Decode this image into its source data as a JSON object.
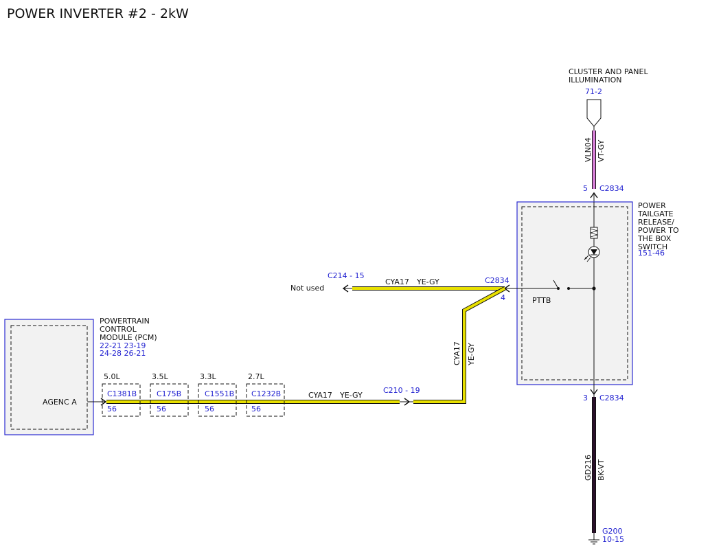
{
  "title": "POWER INVERTER #2 - 2kW",
  "colors": {
    "ye_gy_wire": "#e8e000",
    "vt_gy_wire": "#d77fd8",
    "bk_vt_wire": "#2a0f2a",
    "module_border": "#2b2bd0",
    "ref_blue": "#1f1fd0"
  },
  "cluster": {
    "line1": "CLUSTER AND PANEL",
    "line2": "ILLUMINATION",
    "ref": "71-2"
  },
  "wire_vln04": {
    "circuit": "VLN04",
    "color": "VT-GY"
  },
  "switch_module": {
    "line1": "POWER",
    "line2": "TAILGATE",
    "line3": "RELEASE/",
    "line4": "POWER TO",
    "line5": "THE BOX",
    "line6": "SWITCH",
    "ref": "151-46",
    "top_pin": "5",
    "top_connector": "C2834",
    "left_connector": "C2834",
    "left_pin": "4",
    "switch_label": "PTTB",
    "bottom_pin": "3",
    "bottom_connector": "C2834"
  },
  "not_used": {
    "label": "Not used",
    "connector": "C214 - 15",
    "circuit": "CYA17",
    "color": "YE-GY"
  },
  "vertical_wire": {
    "circuit": "CYA17",
    "color": "YE-GY"
  },
  "pcm": {
    "line1": "POWERTRAIN",
    "line2": "CONTROL",
    "line3": "MODULE (PCM)",
    "ref1": "22-21 23-19",
    "ref2": "24-28 26-21",
    "pin_label": "AGENC A"
  },
  "engine_connectors": [
    {
      "engine": "5.0L",
      "connector": "C1381B",
      "pin": "56"
    },
    {
      "engine": "3.5L",
      "connector": "C175B",
      "pin": "56"
    },
    {
      "engine": "3.3L",
      "connector": "C1551B",
      "pin": "56"
    },
    {
      "engine": "2.7L",
      "connector": "C1232B",
      "pin": "56"
    }
  ],
  "bottom_wire": {
    "circuit": "CYA17",
    "color": "YE-GY",
    "connector": "C210 - 19"
  },
  "ground_wire": {
    "circuit": "GD216",
    "color": "BK-VT"
  },
  "ground": {
    "name": "G200",
    "ref": "10-15"
  }
}
